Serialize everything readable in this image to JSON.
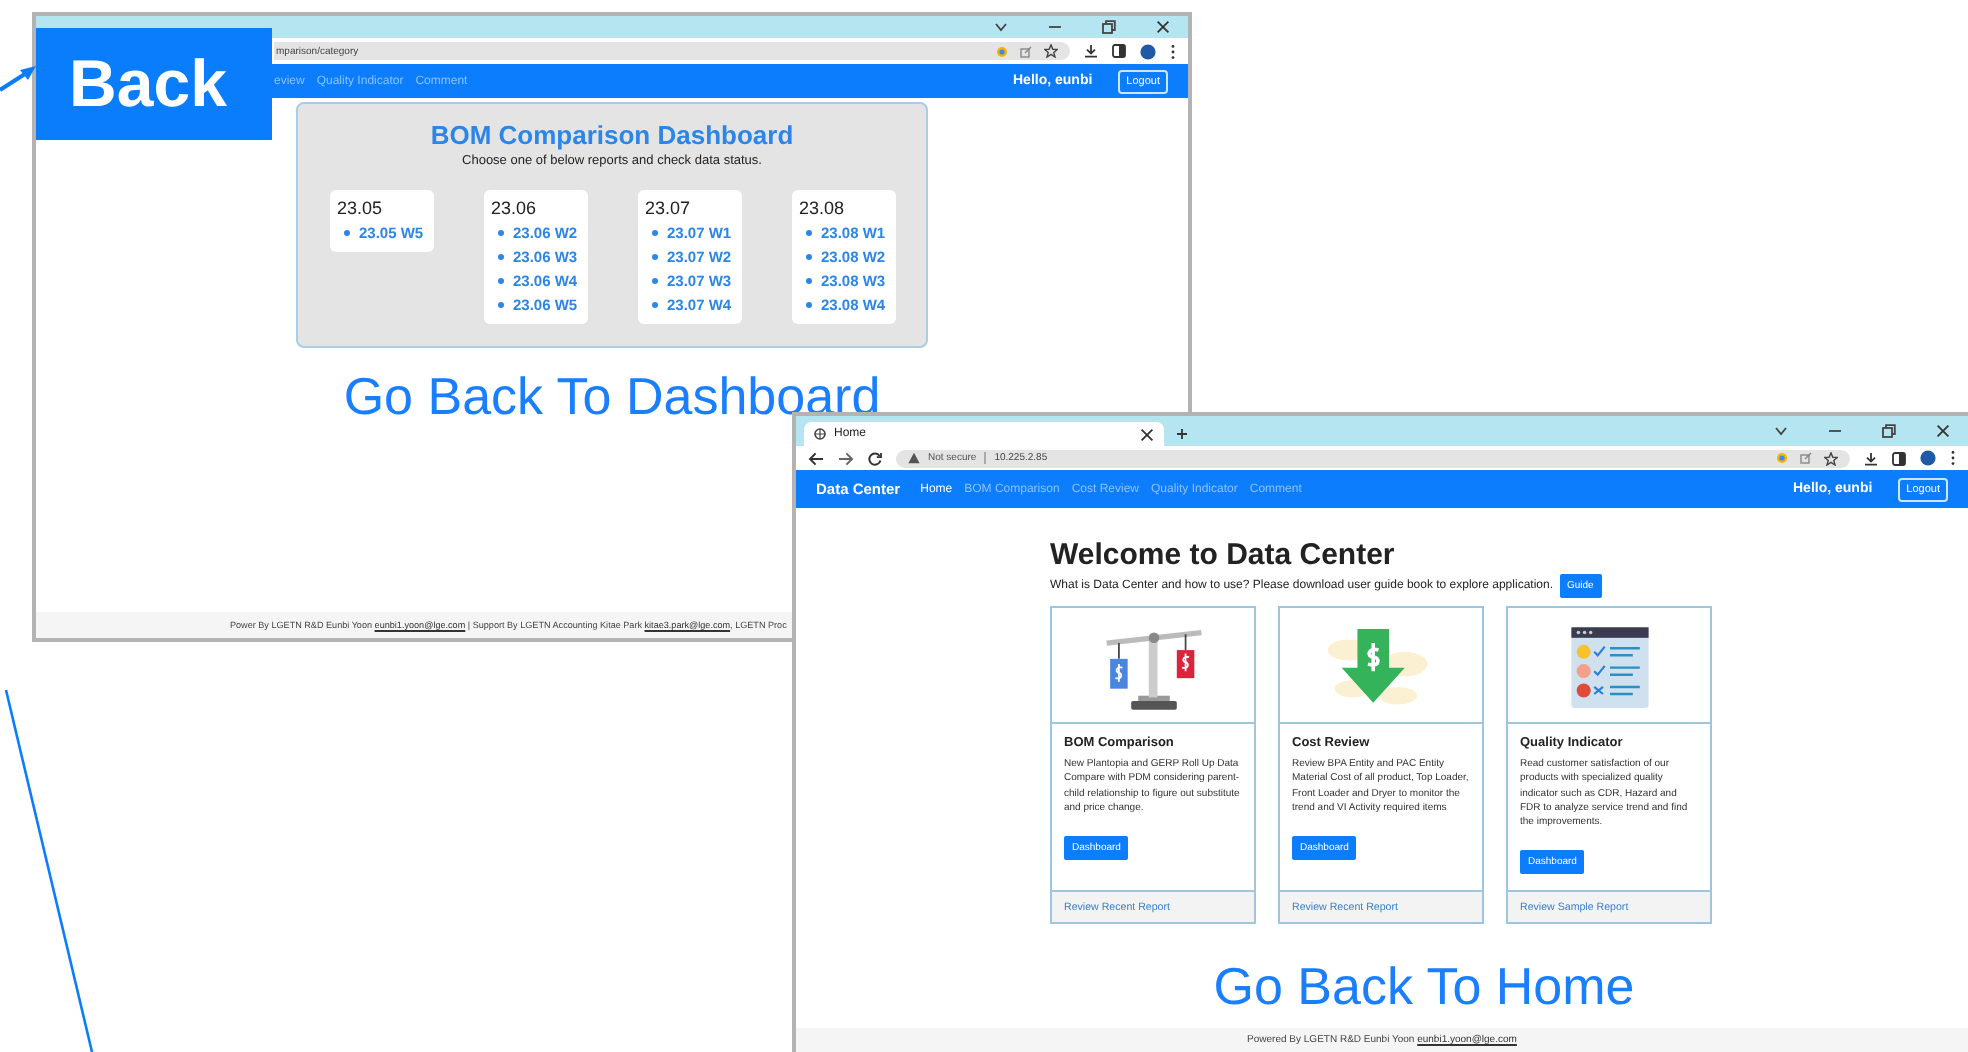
{
  "callout": {
    "label": "Back"
  },
  "dashboard_window": {
    "address": "mparison/category",
    "nav_links": [
      {
        "label": "eview",
        "selected": false
      },
      {
        "label": "Quality Indicator",
        "selected": false
      },
      {
        "label": "Comment",
        "selected": false
      }
    ],
    "greeting": "Hello, eunbi",
    "logout": "Logout",
    "panel": {
      "title": "BOM Comparison Dashboard",
      "subtitle": "Choose one of below reports and check data status.",
      "months": [
        {
          "label": "23.05",
          "reports": [
            "23.05 W5"
          ]
        },
        {
          "label": "23.06",
          "reports": [
            "23.06 W2",
            "23.06 W3",
            "23.06 W4",
            "23.06 W5"
          ]
        },
        {
          "label": "23.07",
          "reports": [
            "23.07 W1",
            "23.07 W2",
            "23.07 W3",
            "23.07 W4"
          ]
        },
        {
          "label": "23.08",
          "reports": [
            "23.08 W1",
            "23.08 W2",
            "23.08 W3",
            "23.08 W4"
          ]
        }
      ]
    },
    "back_link": "Go Back To Dashboard",
    "footer": [
      {
        "kind": "text",
        "text": "Power By LGETN R&D Eunbi Yoon "
      },
      {
        "kind": "link",
        "text": "eunbi1.yoon@lge.com"
      },
      {
        "kind": "text",
        "text": " | Support By LGETN Accounting Kitae Park "
      },
      {
        "kind": "link",
        "text": "kitae3.park@lge.com"
      },
      {
        "kind": "text",
        "text": ", LGETN Proc"
      }
    ]
  },
  "home_window": {
    "tab": "Home",
    "security": "Not secure",
    "address": "10.225.2.85",
    "brand": "Data Center",
    "nav_links": [
      {
        "label": "Home",
        "selected": true
      },
      {
        "label": "BOM Comparison",
        "selected": false
      },
      {
        "label": "Cost Review",
        "selected": false
      },
      {
        "label": "Quality Indicator",
        "selected": false
      },
      {
        "label": "Comment",
        "selected": false
      }
    ],
    "greeting": "Hello, eunbi",
    "logout": "Logout",
    "welcome": {
      "title": "Welcome to Data Center",
      "text": "What is Data Center and how to use? Please download user guide book to explore application.",
      "button": "Guide"
    },
    "cards": [
      {
        "kind": "scale",
        "title": "BOM Comparison",
        "description": "New Plantopia and GERP Roll Up Data Compare with PDM considering parent-child relationship to figure out substitute and price change.",
        "button": "Dashboard",
        "link": "Review Recent Report"
      },
      {
        "kind": "money-arrow",
        "title": "Cost Review",
        "description": "Review BPA Entity and PAC Entity Material Cost of all product, Top Loader, Front Loader and Dryer to monitor the trend and VI Activity required items",
        "button": "Dashboard",
        "link": "Review Recent Report"
      },
      {
        "kind": "survey",
        "title": "Quality Indicator",
        "description": "Read customer satisfaction of our products with specialized quality indicator such as CDR, Hazard and FDR to analyze service trend and find the improvements.",
        "button": "Dashboard",
        "link": "Review Sample Report"
      }
    ],
    "back_link": "Go Back To Home",
    "footer": [
      {
        "kind": "text",
        "text": "Powered By LGETN R&D Eunbi Yoon "
      },
      {
        "kind": "link",
        "text": "eunbi1.yoon@lge.com"
      }
    ]
  }
}
